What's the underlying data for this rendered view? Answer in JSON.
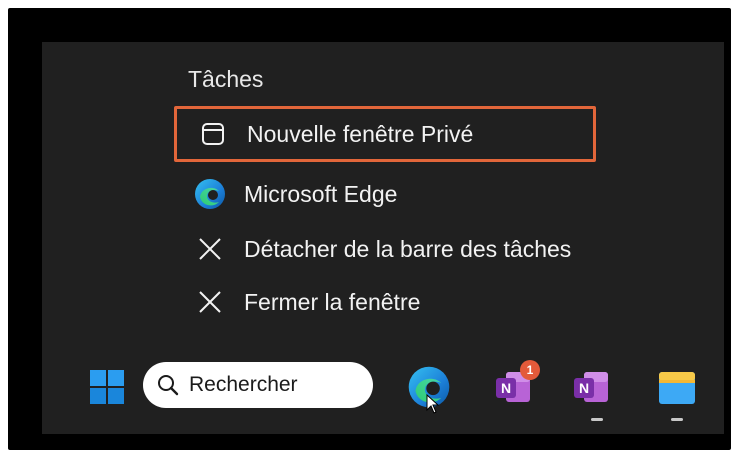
{
  "jump_list": {
    "heading": "Tâches",
    "items": [
      {
        "label": "Nouvelle fenêtre Privé",
        "icon": "private-window-icon",
        "highlighted": true
      },
      {
        "label": "Microsoft Edge",
        "icon": "edge-icon",
        "highlighted": false
      },
      {
        "label": "Détacher de la barre des tâches",
        "icon": "unpin-icon",
        "highlighted": false
      },
      {
        "label": "Fermer la fenêtre",
        "icon": "close-icon",
        "highlighted": false
      }
    ],
    "highlight_color": "#e2663a"
  },
  "taskbar": {
    "search_placeholder": "Rechercher",
    "apps": [
      {
        "name": "Microsoft Edge",
        "icon": "edge-icon",
        "active": false
      },
      {
        "name": "OneNote",
        "icon": "onenote-icon",
        "badge": "1",
        "active": false
      },
      {
        "name": "OneNote",
        "icon": "onenote-icon",
        "active": true
      },
      {
        "name": "File Explorer",
        "icon": "file-explorer-icon",
        "active": true
      }
    ],
    "accent_color": "#0078d4"
  }
}
